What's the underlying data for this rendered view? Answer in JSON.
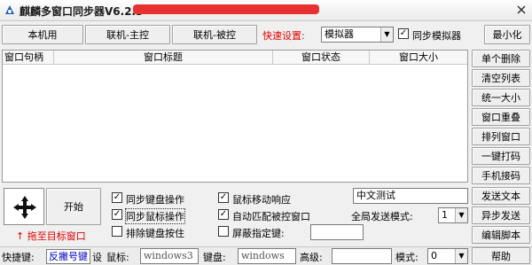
{
  "window": {
    "title": "麒麟多窗口同步器V6.2.3-"
  },
  "top_bar": {
    "tab_local": "本机用",
    "tab_master": "联机-主控",
    "tab_slave": "联机-被控",
    "quick_settings_label": "快速设置:",
    "mode_select_value": "模拟器",
    "sync_emulator_label": "同步模拟器",
    "sync_emulator_checked": true,
    "minimize_label": "最小化"
  },
  "table": {
    "columns": [
      "窗口句柄",
      "窗口标题",
      "窗口状态",
      "窗口大小"
    ],
    "rows": []
  },
  "side_buttons": [
    "单个删除",
    "清空列表",
    "统一大小",
    "窗口重叠",
    "排列窗口",
    "一键打码",
    "手机接码"
  ],
  "bottom": {
    "start_label": "开始",
    "drag_hint": "↑ 拖至目标窗口",
    "opt_sync_keyboard": {
      "label": "同步键盘操作",
      "checked": true
    },
    "opt_sync_mouse": {
      "label": "同步鼠标操作",
      "checked": true
    },
    "opt_exclude_keys": {
      "label": "排除键盘按住",
      "checked": false
    },
    "opt_mouse_move": {
      "label": "鼠标移动响应",
      "checked": true
    },
    "opt_auto_match": {
      "label": "自动匹配被控窗口",
      "checked": true
    },
    "opt_block_keys": {
      "label": "屏蔽指定键:",
      "checked": false
    },
    "text_input_value": "中文测试",
    "send_text_label": "发送文本",
    "global_send_mode_label": "全局发送模式:",
    "global_send_mode_value": "1",
    "async_send_label": "异步发送",
    "edit_script_label": "编辑脚本",
    "help_label": "帮助"
  },
  "status_bar": {
    "hotkey_label": "快捷键:",
    "hotkey_value": "反撇号键",
    "set_label": "设",
    "mouse_label": "鼠标:",
    "mouse_value": "windows3",
    "keyboard_label": "键盘:",
    "keyboard_value": "windows",
    "advanced_label": "高级:",
    "mode_label": "模式:",
    "mode_value": "0"
  }
}
